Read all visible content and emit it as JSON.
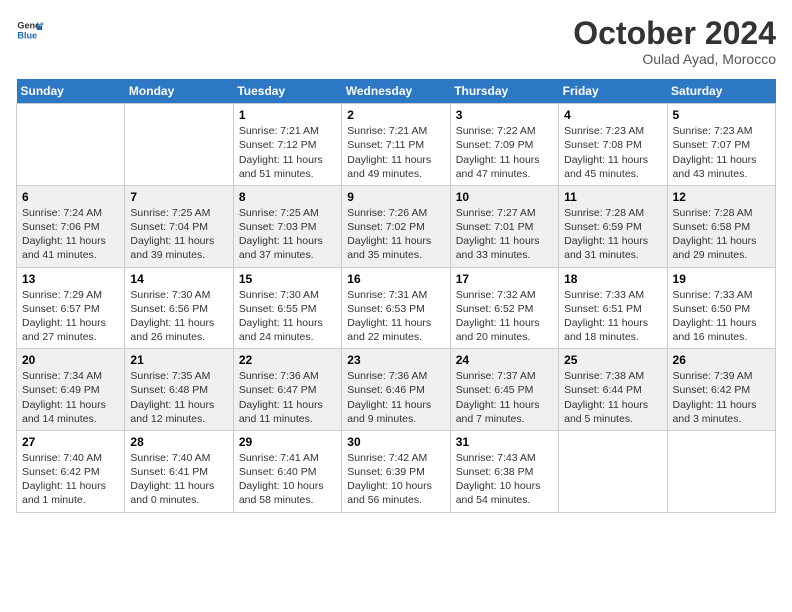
{
  "header": {
    "logo_line1": "General",
    "logo_line2": "Blue",
    "month": "October 2024",
    "location": "Oulad Ayad, Morocco"
  },
  "weekdays": [
    "Sunday",
    "Monday",
    "Tuesday",
    "Wednesday",
    "Thursday",
    "Friday",
    "Saturday"
  ],
  "weeks": [
    [
      {
        "day": "",
        "sunrise": "",
        "sunset": "",
        "daylight": ""
      },
      {
        "day": "",
        "sunrise": "",
        "sunset": "",
        "daylight": ""
      },
      {
        "day": "1",
        "sunrise": "Sunrise: 7:21 AM",
        "sunset": "Sunset: 7:12 PM",
        "daylight": "Daylight: 11 hours and 51 minutes."
      },
      {
        "day": "2",
        "sunrise": "Sunrise: 7:21 AM",
        "sunset": "Sunset: 7:11 PM",
        "daylight": "Daylight: 11 hours and 49 minutes."
      },
      {
        "day": "3",
        "sunrise": "Sunrise: 7:22 AM",
        "sunset": "Sunset: 7:09 PM",
        "daylight": "Daylight: 11 hours and 47 minutes."
      },
      {
        "day": "4",
        "sunrise": "Sunrise: 7:23 AM",
        "sunset": "Sunset: 7:08 PM",
        "daylight": "Daylight: 11 hours and 45 minutes."
      },
      {
        "day": "5",
        "sunrise": "Sunrise: 7:23 AM",
        "sunset": "Sunset: 7:07 PM",
        "daylight": "Daylight: 11 hours and 43 minutes."
      }
    ],
    [
      {
        "day": "6",
        "sunrise": "Sunrise: 7:24 AM",
        "sunset": "Sunset: 7:06 PM",
        "daylight": "Daylight: 11 hours and 41 minutes."
      },
      {
        "day": "7",
        "sunrise": "Sunrise: 7:25 AM",
        "sunset": "Sunset: 7:04 PM",
        "daylight": "Daylight: 11 hours and 39 minutes."
      },
      {
        "day": "8",
        "sunrise": "Sunrise: 7:25 AM",
        "sunset": "Sunset: 7:03 PM",
        "daylight": "Daylight: 11 hours and 37 minutes."
      },
      {
        "day": "9",
        "sunrise": "Sunrise: 7:26 AM",
        "sunset": "Sunset: 7:02 PM",
        "daylight": "Daylight: 11 hours and 35 minutes."
      },
      {
        "day": "10",
        "sunrise": "Sunrise: 7:27 AM",
        "sunset": "Sunset: 7:01 PM",
        "daylight": "Daylight: 11 hours and 33 minutes."
      },
      {
        "day": "11",
        "sunrise": "Sunrise: 7:28 AM",
        "sunset": "Sunset: 6:59 PM",
        "daylight": "Daylight: 11 hours and 31 minutes."
      },
      {
        "day": "12",
        "sunrise": "Sunrise: 7:28 AM",
        "sunset": "Sunset: 6:58 PM",
        "daylight": "Daylight: 11 hours and 29 minutes."
      }
    ],
    [
      {
        "day": "13",
        "sunrise": "Sunrise: 7:29 AM",
        "sunset": "Sunset: 6:57 PM",
        "daylight": "Daylight: 11 hours and 27 minutes."
      },
      {
        "day": "14",
        "sunrise": "Sunrise: 7:30 AM",
        "sunset": "Sunset: 6:56 PM",
        "daylight": "Daylight: 11 hours and 26 minutes."
      },
      {
        "day": "15",
        "sunrise": "Sunrise: 7:30 AM",
        "sunset": "Sunset: 6:55 PM",
        "daylight": "Daylight: 11 hours and 24 minutes."
      },
      {
        "day": "16",
        "sunrise": "Sunrise: 7:31 AM",
        "sunset": "Sunset: 6:53 PM",
        "daylight": "Daylight: 11 hours and 22 minutes."
      },
      {
        "day": "17",
        "sunrise": "Sunrise: 7:32 AM",
        "sunset": "Sunset: 6:52 PM",
        "daylight": "Daylight: 11 hours and 20 minutes."
      },
      {
        "day": "18",
        "sunrise": "Sunrise: 7:33 AM",
        "sunset": "Sunset: 6:51 PM",
        "daylight": "Daylight: 11 hours and 18 minutes."
      },
      {
        "day": "19",
        "sunrise": "Sunrise: 7:33 AM",
        "sunset": "Sunset: 6:50 PM",
        "daylight": "Daylight: 11 hours and 16 minutes."
      }
    ],
    [
      {
        "day": "20",
        "sunrise": "Sunrise: 7:34 AM",
        "sunset": "Sunset: 6:49 PM",
        "daylight": "Daylight: 11 hours and 14 minutes."
      },
      {
        "day": "21",
        "sunrise": "Sunrise: 7:35 AM",
        "sunset": "Sunset: 6:48 PM",
        "daylight": "Daylight: 11 hours and 12 minutes."
      },
      {
        "day": "22",
        "sunrise": "Sunrise: 7:36 AM",
        "sunset": "Sunset: 6:47 PM",
        "daylight": "Daylight: 11 hours and 11 minutes."
      },
      {
        "day": "23",
        "sunrise": "Sunrise: 7:36 AM",
        "sunset": "Sunset: 6:46 PM",
        "daylight": "Daylight: 11 hours and 9 minutes."
      },
      {
        "day": "24",
        "sunrise": "Sunrise: 7:37 AM",
        "sunset": "Sunset: 6:45 PM",
        "daylight": "Daylight: 11 hours and 7 minutes."
      },
      {
        "day": "25",
        "sunrise": "Sunrise: 7:38 AM",
        "sunset": "Sunset: 6:44 PM",
        "daylight": "Daylight: 11 hours and 5 minutes."
      },
      {
        "day": "26",
        "sunrise": "Sunrise: 7:39 AM",
        "sunset": "Sunset: 6:42 PM",
        "daylight": "Daylight: 11 hours and 3 minutes."
      }
    ],
    [
      {
        "day": "27",
        "sunrise": "Sunrise: 7:40 AM",
        "sunset": "Sunset: 6:42 PM",
        "daylight": "Daylight: 11 hours and 1 minute."
      },
      {
        "day": "28",
        "sunrise": "Sunrise: 7:40 AM",
        "sunset": "Sunset: 6:41 PM",
        "daylight": "Daylight: 11 hours and 0 minutes."
      },
      {
        "day": "29",
        "sunrise": "Sunrise: 7:41 AM",
        "sunset": "Sunset: 6:40 PM",
        "daylight": "Daylight: 10 hours and 58 minutes."
      },
      {
        "day": "30",
        "sunrise": "Sunrise: 7:42 AM",
        "sunset": "Sunset: 6:39 PM",
        "daylight": "Daylight: 10 hours and 56 minutes."
      },
      {
        "day": "31",
        "sunrise": "Sunrise: 7:43 AM",
        "sunset": "Sunset: 6:38 PM",
        "daylight": "Daylight: 10 hours and 54 minutes."
      },
      {
        "day": "",
        "sunrise": "",
        "sunset": "",
        "daylight": ""
      },
      {
        "day": "",
        "sunrise": "",
        "sunset": "",
        "daylight": ""
      }
    ]
  ]
}
